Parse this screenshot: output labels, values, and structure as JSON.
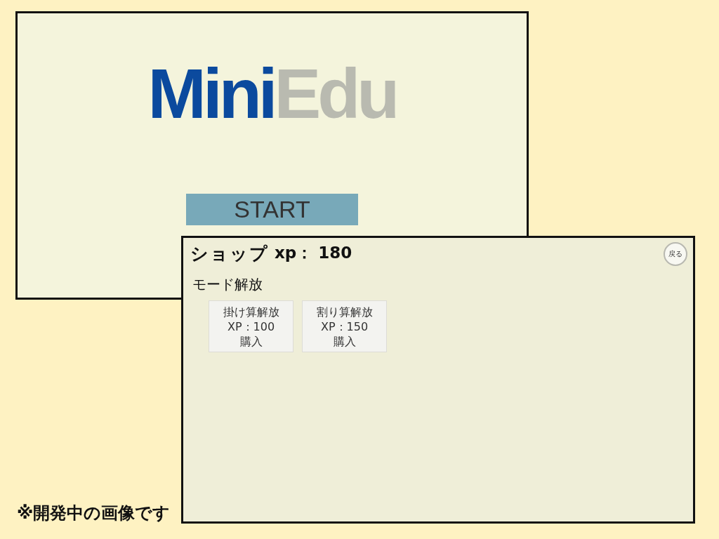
{
  "screens": [
    {
      "kind": "title",
      "logo": [
        {
          "text": "Mini",
          "color": "#0b4a9e"
        },
        {
          "text": "Edu",
          "color": "#b9bab0"
        }
      ],
      "start_button": "START"
    },
    {
      "kind": "shop",
      "title": "ショップ",
      "xp": "xp： 180",
      "back_button": "戻る",
      "section_title": "モード解放",
      "items": [
        {
          "name": "掛け算解放",
          "price": "XP：100",
          "action": "購入"
        },
        {
          "name": "割り算解放",
          "price": "XP：150",
          "action": "購入"
        }
      ]
    }
  ],
  "caption": "※開発中の画像です"
}
